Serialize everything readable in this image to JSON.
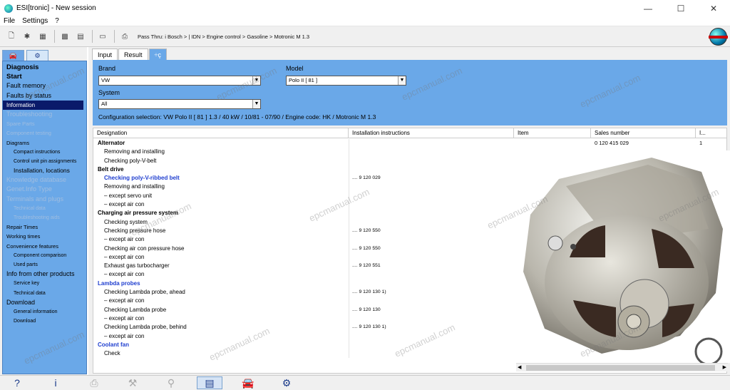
{
  "window": {
    "title": "ESI[tronic] - New session"
  },
  "menu": [
    "File",
    "Settings",
    "?"
  ],
  "toolbar": {
    "breadcrumb": "Pass Thru: i Bosch > | IDN > Engine control > Gasoline > Motronic M 1.3"
  },
  "sidebar": {
    "items": [
      {
        "label": "Diagnosis",
        "style": "l0b"
      },
      {
        "label": "Start",
        "style": "l0b"
      },
      {
        "label": "Fault memory",
        "style": "l0"
      },
      {
        "label": "Faults by status",
        "style": "l0"
      },
      {
        "label": "Information",
        "style": "sel"
      },
      {
        "label": "Troubleshooting",
        "style": "l0 dis"
      },
      {
        "label": "Spare Parts",
        "style": "l1 dis"
      },
      {
        "label": "Component testing",
        "style": "l1 dis"
      },
      {
        "label": "Diagrams",
        "style": "l1"
      },
      {
        "label": "Compact instructions",
        "style": "l2"
      },
      {
        "label": "Control unit pin assignments",
        "style": "l2"
      },
      {
        "label": "Installation, locations",
        "style": "l2b"
      },
      {
        "label": "Knowledge database",
        "style": "l0 dis"
      },
      {
        "label": "Genet.Info Type",
        "style": "l0 dis"
      },
      {
        "label": "Terminals and plugs",
        "style": "l0 dis"
      },
      {
        "label": "Technical data",
        "style": "l2 dis"
      },
      {
        "label": "Troubleshooting aids",
        "style": "l2 dis"
      },
      {
        "label": "Repair Times",
        "style": "l1"
      },
      {
        "label": "Working times",
        "style": "l1"
      },
      {
        "label": "Convenience features",
        "style": "l1"
      },
      {
        "label": "Component comparison",
        "style": "l2"
      },
      {
        "label": "Used parts",
        "style": "l2"
      },
      {
        "label": "Info from other products",
        "style": "l0"
      },
      {
        "label": "Service key",
        "style": "l2"
      },
      {
        "label": "Technical data",
        "style": "l2"
      },
      {
        "label": "Download",
        "style": "l0"
      },
      {
        "label": "General information",
        "style": "l2"
      },
      {
        "label": "Download",
        "style": "l2"
      }
    ]
  },
  "tabs": [
    "Input",
    "Result",
    "÷ç"
  ],
  "config": {
    "brand_label": "Brand",
    "brand_value": "VW",
    "model_label": "Model",
    "model_value": "Polo II [ 81 ]",
    "system_label": "System",
    "system_value": "All",
    "selection": "Configuration selection: VW Polo II [ 81 ] 1.3 / 40 kW / 10/81 - 07/90 / Engine code: HK / Motronic M 1.3"
  },
  "grid": {
    "headers": [
      "Designation",
      "Installation instructions",
      "Item",
      "Sales number",
      "I..."
    ],
    "rows": [
      {
        "d": "Alternator",
        "i": "",
        "s": "head"
      },
      {
        "d": "Removing and installing",
        "i": "",
        "s": "ind"
      },
      {
        "d": "Checking poly-V-belt",
        "i": "",
        "s": "ind"
      },
      {
        "d": "Belt drive",
        "i": "",
        "s": "head"
      },
      {
        "d": "Checking poly-V-ribbed belt",
        "i": ".... 9 120 029",
        "s": "blue ind"
      },
      {
        "d": "Removing and installing",
        "i": "",
        "s": "ind"
      },
      {
        "d": "– except servo unit",
        "i": "",
        "s": "sub"
      },
      {
        "d": "– except air con",
        "i": "",
        "s": "sub"
      },
      {
        "d": "Charging air pressure system",
        "i": "",
        "s": "head"
      },
      {
        "d": "Checking system",
        "i": "",
        "s": "ind"
      },
      {
        "d": "Checking pressure hose",
        "i": ".... 9 120 550",
        "s": "ind"
      },
      {
        "d": "– except air con",
        "i": "",
        "s": "sub"
      },
      {
        "d": "Checking air con pressure hose",
        "i": ".... 9 120 550",
        "s": "ind"
      },
      {
        "d": "– except air con",
        "i": "",
        "s": "sub"
      },
      {
        "d": "Exhaust gas turbocharger",
        "i": ".... 9 120 551",
        "s": "ind"
      },
      {
        "d": "– except air con",
        "i": "",
        "s": "sub"
      },
      {
        "d": "Lambda probes",
        "i": "",
        "s": "blue"
      },
      {
        "d": "Checking Lambda probe, ahead",
        "i": ".... 9 120 130 1)",
        "s": "ind"
      },
      {
        "d": "– except air con",
        "i": "",
        "s": "sub"
      },
      {
        "d": "Checking Lambda probe",
        "i": ".... 9 120 130",
        "s": "ind"
      },
      {
        "d": "– except air con",
        "i": "",
        "s": "sub"
      },
      {
        "d": "Checking Lambda probe, behind",
        "i": ".... 9 120 130 1)",
        "s": "ind"
      },
      {
        "d": "– except air con",
        "i": "",
        "s": "sub"
      },
      {
        "d": "Coolant fan",
        "i": "",
        "s": "blue"
      },
      {
        "d": "Check",
        "i": "",
        "s": "ind"
      }
    ],
    "sales_row": {
      "item": "",
      "sales_number": "0 120 415 029",
      "i": "1"
    }
  },
  "watermark": "epcmanual.com",
  "colors": {
    "panel_blue": "#6aa8e8",
    "selected": "#0a1a6a",
    "link_blue": "#1f3ecf"
  }
}
